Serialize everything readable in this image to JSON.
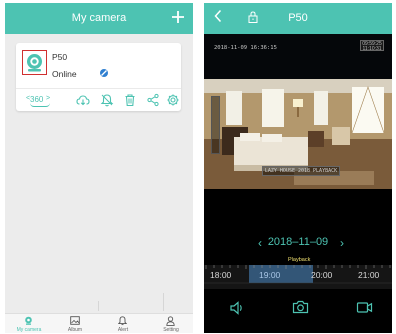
{
  "left_screen": {
    "title": "My camera",
    "add_icon": "plus-icon",
    "camera": {
      "name": "P50",
      "status": "Online",
      "action_360_label": "360"
    },
    "tabs": [
      {
        "label": "My camera",
        "icon": "camera-icon",
        "active": true
      },
      {
        "label": "Album",
        "icon": "album-icon",
        "active": false
      },
      {
        "label": "Alert",
        "icon": "bell-icon",
        "active": false
      },
      {
        "label": "Setting",
        "icon": "person-icon",
        "active": false
      }
    ]
  },
  "right_screen": {
    "title": "P50",
    "osd_timestamp": "2018-11-09 16:36:15",
    "osd_badge_text": "09:59:25\n11:10:31",
    "osd_camera_label": "LAZY HOUSE 2018 PLAYBACK",
    "date": "2018–11–09",
    "playback_label": "Playback",
    "timeline_labels": [
      "18:00",
      "19:00",
      "20:00",
      "21:00"
    ],
    "highlight_label_index": 1
  },
  "colors": {
    "accent": "#4dc3b2",
    "left_background": "#ececec",
    "right_background": "#000000"
  }
}
